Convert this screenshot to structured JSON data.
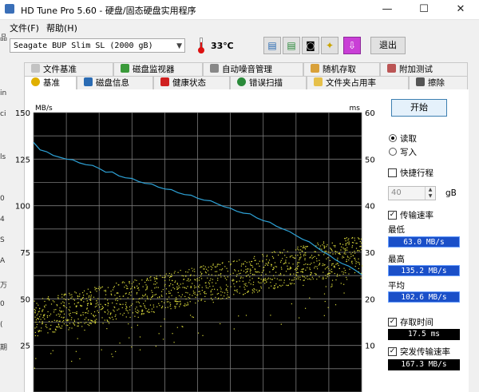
{
  "window": {
    "title": "HD Tune Pro 5.60 - 硬盘/固态硬盘实用程序",
    "min": "—",
    "max": "☐",
    "close": "✕"
  },
  "menu": {
    "file": "文件(F)",
    "help": "帮助(H)"
  },
  "toolbar": {
    "drive": "Seagate BUP Slim SL (2000 gB)",
    "temperature": "33℃",
    "exit": "退出",
    "buttons": [
      "copy-icon",
      "copy-text-icon",
      "camera-icon",
      "options-icon",
      "save-down-icon"
    ]
  },
  "tabs_row1": [
    "文件基准",
    "磁盘监视器",
    "自动噪音管理",
    "随机存取",
    "附加测试"
  ],
  "tabs_row2": [
    "基准",
    "磁盘信息",
    "健康状态",
    "错误扫描",
    "文件夹占用率",
    "擦除"
  ],
  "left_edge_fragments": [
    "品",
    "in",
    "ci",
    "ls",
    "0",
    "4",
    "S",
    "A",
    "万",
    "0",
    "(",
    "期"
  ],
  "chart_data": {
    "type": "scatter",
    "x_range": [
      0,
      2000
    ],
    "y_left": {
      "unit": "MB/s",
      "ylim": [
        0,
        150
      ],
      "ticks": [
        "150",
        "125",
        "100",
        "75",
        "50",
        "25"
      ]
    },
    "y_right": {
      "unit": "ms",
      "ylim": [
        0,
        60
      ],
      "ticks": [
        "60",
        "50",
        "40",
        "30",
        "20",
        "10"
      ]
    },
    "grid": "on",
    "colors": {
      "transfer": "#2ea3d8",
      "access": "#d7d73a",
      "grid": "#7a7a7a",
      "background": "#000000"
    },
    "series": [
      {
        "role": "transfer",
        "y_units": "MB/s",
        "x": [
          0,
          40,
          80,
          120,
          160,
          200,
          240,
          280,
          320,
          360,
          400,
          440,
          480,
          520,
          560,
          600,
          640,
          680,
          720,
          760,
          800,
          840,
          880,
          920,
          960,
          1000,
          1040,
          1080,
          1120,
          1160,
          1200,
          1240,
          1280,
          1320,
          1360,
          1400,
          1440,
          1480,
          1520,
          1560,
          1600,
          1640,
          1680,
          1720,
          1760,
          1800,
          1840,
          1880,
          1920,
          1960,
          2000
        ],
        "y": [
          134,
          130,
          129,
          127,
          126,
          125,
          124,
          123,
          122,
          121,
          120,
          118,
          117.5,
          116,
          115,
          114,
          113,
          112,
          111,
          110,
          109,
          108,
          107,
          106,
          105,
          104,
          103,
          102,
          101,
          99.5,
          98,
          97,
          96,
          95,
          93.5,
          92,
          90.5,
          89,
          87.5,
          85.5,
          84,
          82,
          80,
          78,
          75.5,
          73,
          71,
          69,
          67,
          65.5,
          63
        ]
      },
      {
        "role": "access",
        "y_units": "ms",
        "point_count": 1400,
        "trend_start": [
          12,
          20
        ],
        "trend_end": [
          26,
          34
        ]
      }
    ]
  },
  "sidebar": {
    "start": "开始",
    "read": "读取",
    "write": "写入",
    "short_stroke": "快捷行程",
    "short_stroke_value": "40",
    "short_stroke_unit": "gB",
    "transfer_rate": "传输速率",
    "min_label": "最低",
    "min_value": "63.0 MB/s",
    "max_label": "最高",
    "max_value": "135.2 MB/s",
    "avg_label": "平均",
    "avg_value": "102.6 MB/s",
    "access_time": "存取时间",
    "access_value": "17.5 ms",
    "burst_rate": "突发传输速率",
    "burst_value": "167.3 MB/s"
  }
}
